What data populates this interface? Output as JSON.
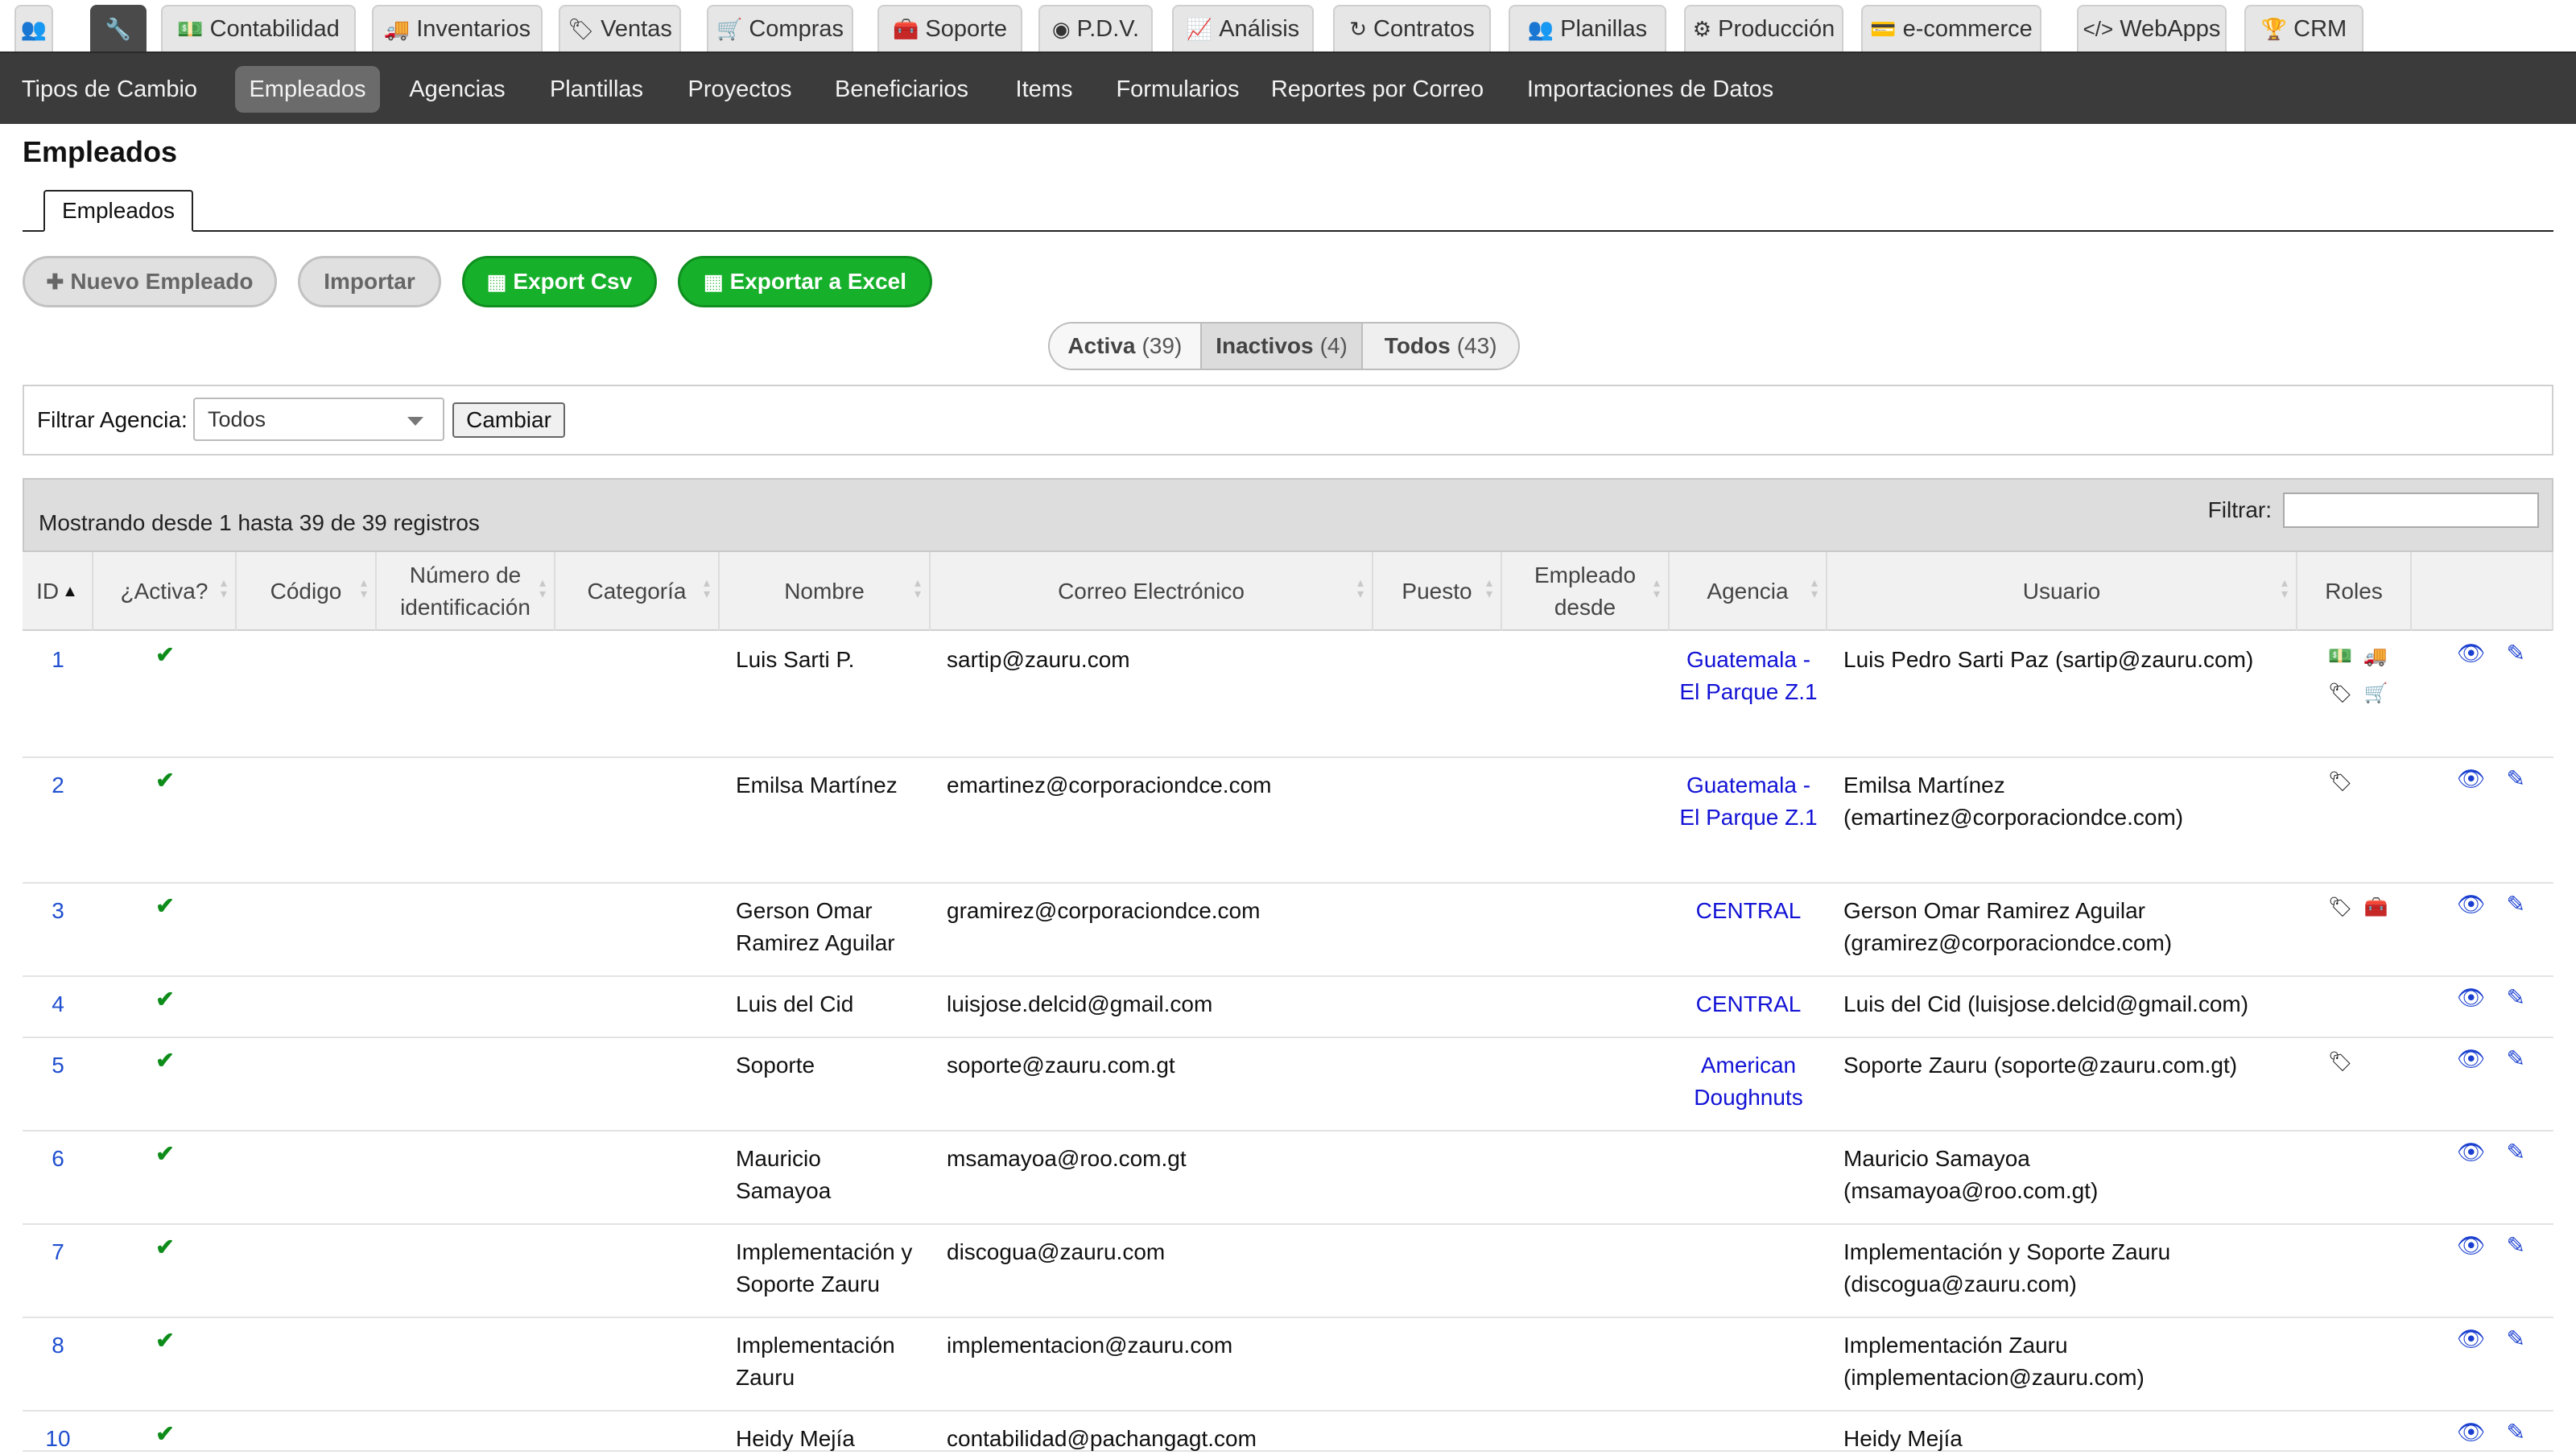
{
  "module_tabs": [
    {
      "icon": "users-icon",
      "glyph": "👥",
      "label": ""
    },
    {
      "icon": "wrench-icon",
      "glyph": "🔧",
      "label": "",
      "active": true
    },
    {
      "icon": "money-icon",
      "glyph": "💵",
      "label": "Contabilidad"
    },
    {
      "icon": "truck-icon",
      "glyph": "🚚",
      "label": "Inventarios"
    },
    {
      "icon": "tags-icon",
      "glyph": "🏷",
      "label": "Ventas"
    },
    {
      "icon": "cart-icon",
      "glyph": "🛒",
      "label": "Compras"
    },
    {
      "icon": "medkit-icon",
      "glyph": "🧰",
      "label": "Soporte"
    },
    {
      "icon": "dot-circle-icon",
      "glyph": "◉",
      "label": "P.D.V."
    },
    {
      "icon": "chart-line-icon",
      "glyph": "📈",
      "label": "Análisis"
    },
    {
      "icon": "refresh-icon",
      "glyph": "↻",
      "label": "Contratos"
    },
    {
      "icon": "users-icon",
      "glyph": "👥",
      "label": "Planillas"
    },
    {
      "icon": "cogs-icon",
      "glyph": "⚙",
      "label": "Producción"
    },
    {
      "icon": "credit-card-icon",
      "glyph": "💳",
      "label": "e-commerce"
    },
    {
      "icon": "code-icon",
      "glyph": "</>",
      "label": "WebApps"
    },
    {
      "icon": "trophy-icon",
      "glyph": "🏆",
      "label": "CRM"
    }
  ],
  "sub_nav": [
    {
      "label": "Tipos de Cambio"
    },
    {
      "label": "Empleados",
      "active": true
    },
    {
      "label": "Agencias"
    },
    {
      "label": "Plantillas"
    },
    {
      "label": "Proyectos"
    },
    {
      "label": "Beneficiarios"
    },
    {
      "label": "Items"
    },
    {
      "label": "Formularios"
    },
    {
      "label": "Reportes por Correo"
    },
    {
      "label": "Importaciones de Datos"
    }
  ],
  "page": {
    "title": "Empleados",
    "tab_label": "Empleados"
  },
  "actions": {
    "new_label": "Nuevo Empleado",
    "new_icon": "plus-icon",
    "import_label": "Importar",
    "csv_label": "Export Csv",
    "csv_icon": "table-icon",
    "excel_label": "Exportar a Excel",
    "excel_icon": "table-icon"
  },
  "status_filter": [
    {
      "label": "Activa",
      "count": "(39)",
      "active": true
    },
    {
      "label": "Inactivos",
      "count": "(4)"
    },
    {
      "label": "Todos",
      "count": "(43)"
    }
  ],
  "agency_filter": {
    "label": "Filtrar Agencia:",
    "selected": "Todos",
    "button": "Cambiar"
  },
  "table": {
    "info": "Mostrando desde 1 hasta 39 de 39 registros",
    "filter_label": "Filtrar:",
    "filter_value": "",
    "columns": [
      "ID",
      "¿Activa?",
      "Código",
      "Número de identificación",
      "Categoría",
      "Nombre",
      "Correo Electrónico",
      "Puesto",
      "Empleado desde",
      "Agencia",
      "Usuario",
      "Roles",
      ""
    ],
    "sort_column": "ID",
    "rows": [
      {
        "id": "1",
        "active": true,
        "code": "",
        "ident": "",
        "category": "",
        "name": "Luis Sarti P.",
        "email": "sartip@zauru.com",
        "position": "",
        "since": "",
        "agency": "Guatemala - El Parque Z.1",
        "user": "Luis Pedro Sarti Paz (sartip@zauru.com)",
        "roles": [
          "money-icon",
          "truck-icon",
          "tags-icon",
          "cart-icon"
        ]
      },
      {
        "id": "2",
        "active": true,
        "code": "",
        "ident": "",
        "category": "",
        "name": "Emilsa Martínez",
        "email": "emartinez@corporaciondce.com",
        "position": "",
        "since": "",
        "agency": "Guatemala - El Parque Z.1",
        "user": "Emilsa Martínez (emartinez@corporaciondce.com)",
        "roles": [
          "tags-icon"
        ]
      },
      {
        "id": "3",
        "active": true,
        "code": "",
        "ident": "",
        "category": "",
        "name": "Gerson Omar Ramirez Aguilar",
        "email": "gramirez@corporaciondce.com",
        "position": "",
        "since": "",
        "agency": "CENTRAL",
        "user": "Gerson Omar Ramirez Aguilar (gramirez@corporaciondce.com)",
        "roles": [
          "tags-icon",
          "medkit-icon"
        ]
      },
      {
        "id": "4",
        "active": true,
        "code": "",
        "ident": "",
        "category": "",
        "name": "Luis del Cid",
        "email": "luisjose.delcid@gmail.com",
        "position": "",
        "since": "",
        "agency": "CENTRAL",
        "user": "Luis del Cid (luisjose.delcid@gmail.com)",
        "roles": []
      },
      {
        "id": "5",
        "active": true,
        "code": "",
        "ident": "",
        "category": "",
        "name": "Soporte",
        "email": "soporte@zauru.com.gt",
        "position": "",
        "since": "",
        "agency": "American Doughnuts",
        "user": "Soporte Zauru (soporte@zauru.com.gt)",
        "roles": [
          "tags-icon"
        ]
      },
      {
        "id": "6",
        "active": true,
        "code": "",
        "ident": "",
        "category": "",
        "name": "Mauricio Samayoa",
        "email": "msamayoa@roo.com.gt",
        "position": "",
        "since": "",
        "agency": "",
        "user": "Mauricio Samayoa (msamayoa@roo.com.gt)",
        "roles": []
      },
      {
        "id": "7",
        "active": true,
        "code": "",
        "ident": "",
        "category": "",
        "name": "Implementación y Soporte Zauru",
        "email": "discogua@zauru.com",
        "position": "",
        "since": "",
        "agency": "",
        "user": "Implementación y Soporte Zauru (discogua@zauru.com)",
        "roles": []
      },
      {
        "id": "8",
        "active": true,
        "code": "",
        "ident": "",
        "category": "",
        "name": "Implementación Zauru",
        "email": "implementacion@zauru.com",
        "position": "",
        "since": "",
        "agency": "",
        "user": "Implementación Zauru (implementacion@zauru.com)",
        "roles": []
      },
      {
        "id": "10",
        "active": true,
        "code": "",
        "ident": "",
        "category": "",
        "name": "Heidy Mejía",
        "email": "contabilidad@pachangagt.com",
        "position": "",
        "since": "",
        "agency": "",
        "user": "Heidy Mejía",
        "roles": []
      }
    ]
  },
  "colors": {
    "link": "#1f4fd0",
    "agency_link": "#1212d6",
    "check": "#0e8c1a",
    "green_button": "#17b02b",
    "dark_nav": "#3b3b3b"
  }
}
